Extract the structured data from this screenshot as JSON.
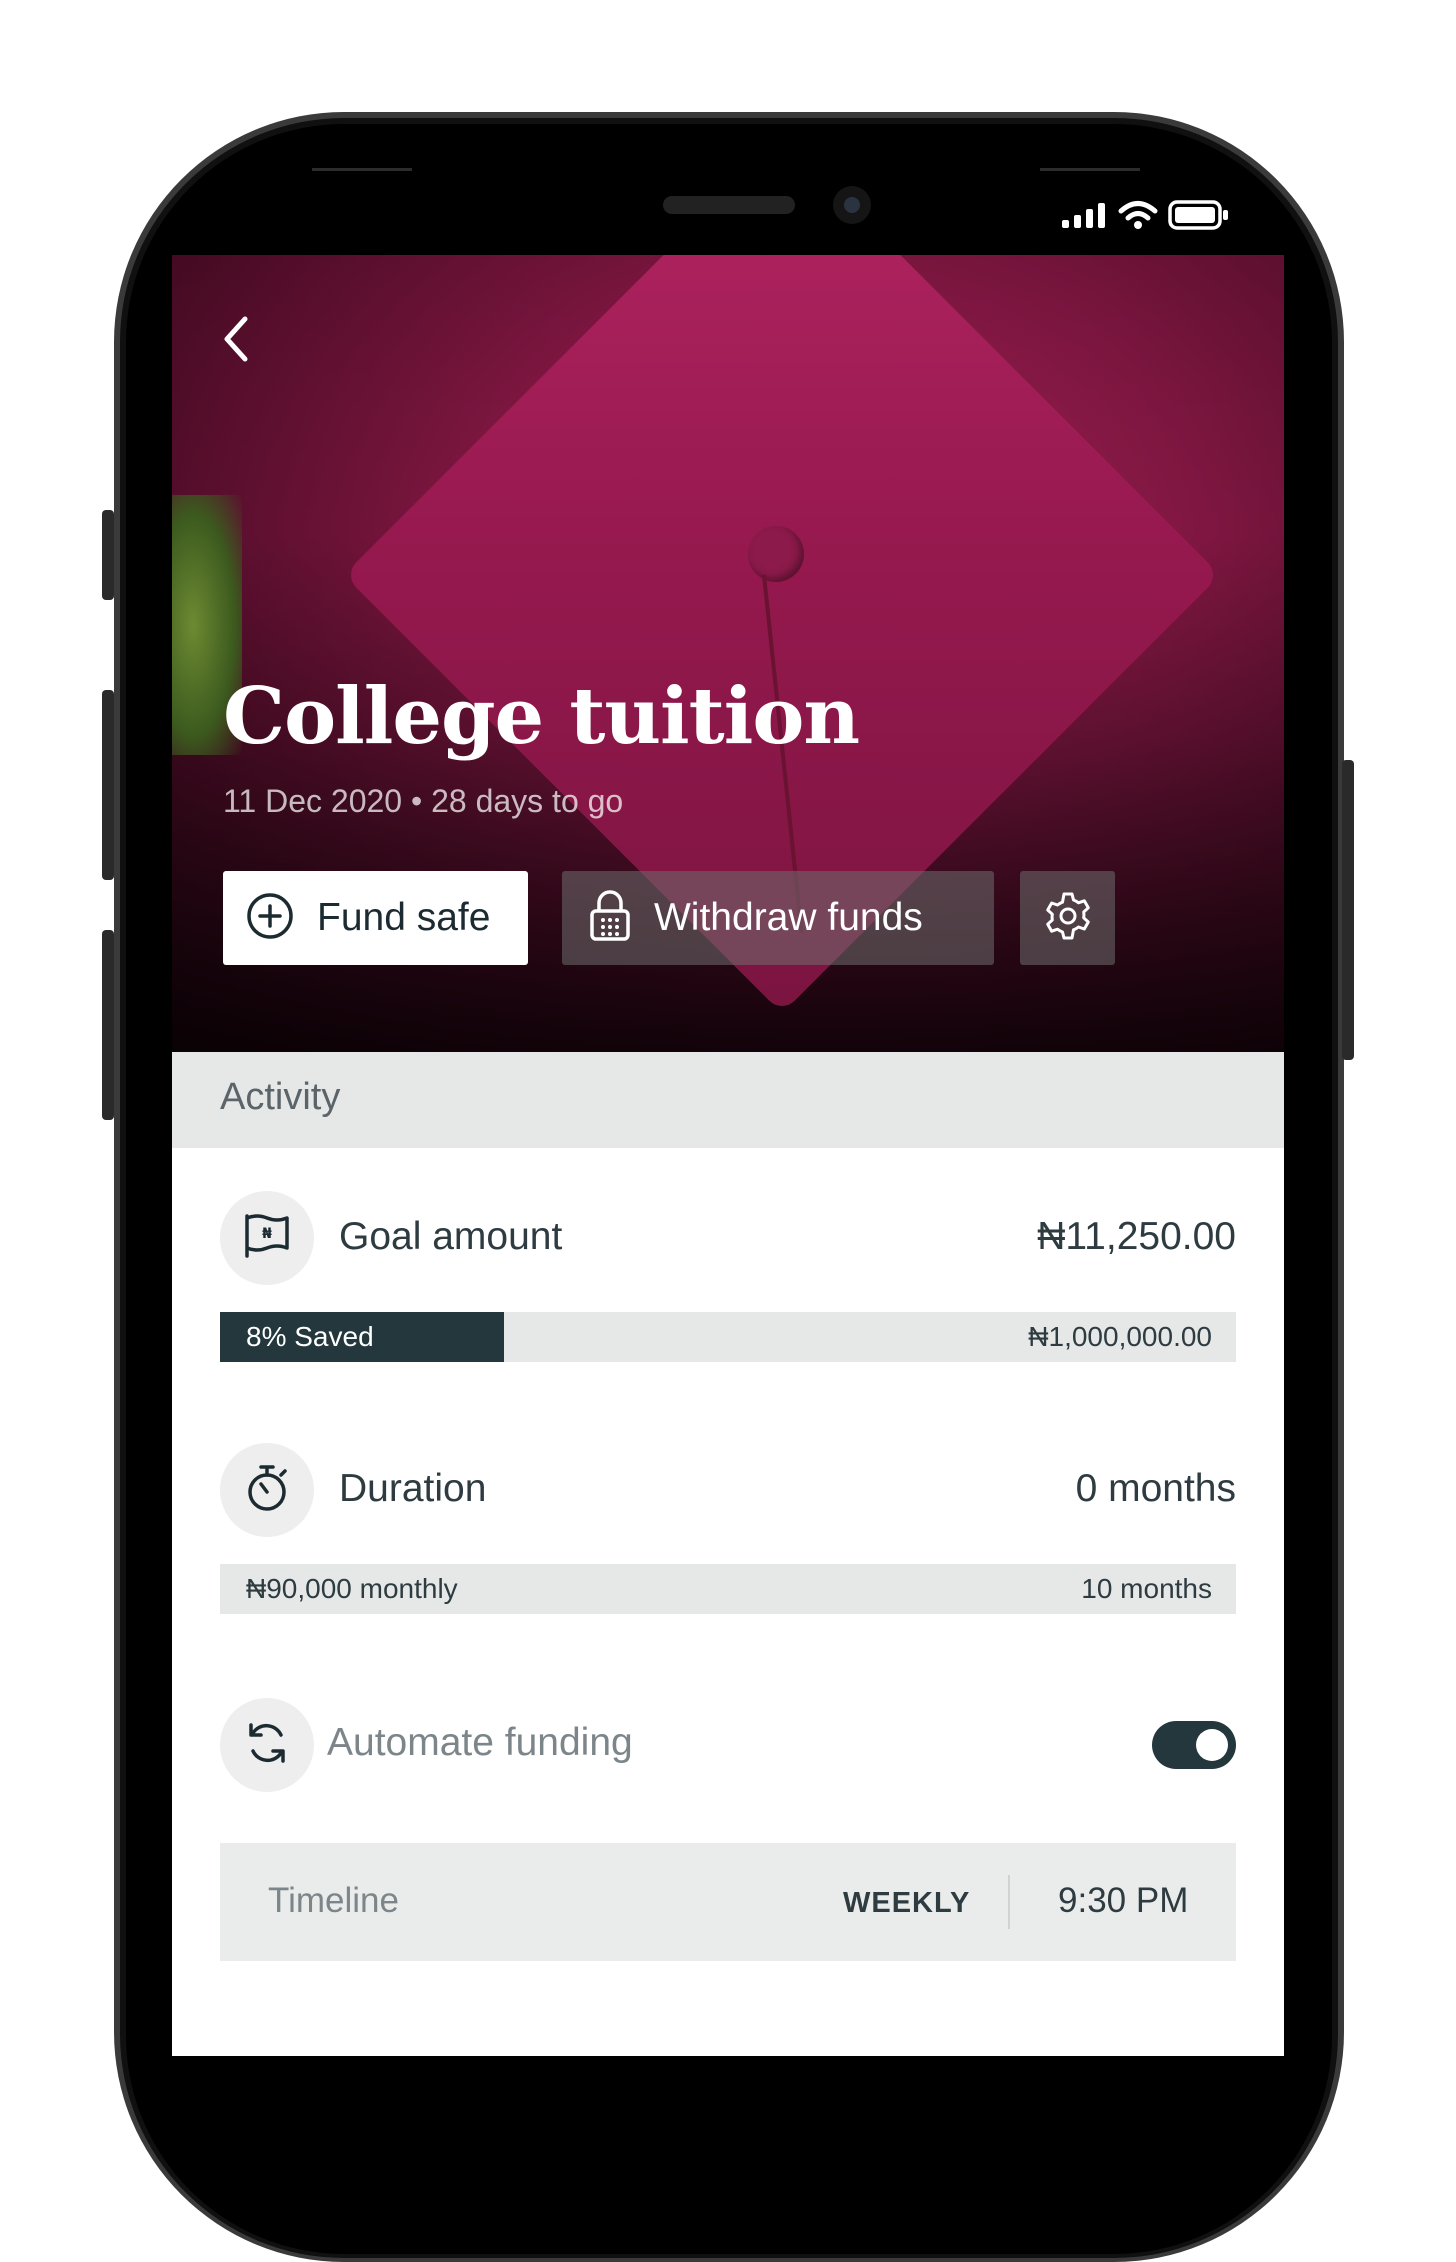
{
  "status_bar": {
    "signal_icon": "cellular-signal-icon",
    "wifi_icon": "wifi-icon",
    "battery_icon": "battery-icon"
  },
  "hero": {
    "back_icon": "chevron-left-icon",
    "title": "College tuition",
    "subtitle": "11 Dec 2020 • 28 days to go",
    "actions": {
      "fund_label": "Fund safe",
      "fund_icon": "plus-circle-icon",
      "withdraw_label": "Withdraw funds",
      "withdraw_icon": "lock-icon",
      "settings_icon": "gear-icon"
    }
  },
  "activity": {
    "header": "Activity",
    "goal": {
      "icon": "naira-flag-icon",
      "label": "Goal amount",
      "value": "₦11,250.00",
      "progress_label": "8% Saved",
      "progress_fraction": 0.28,
      "target": "₦1,000,000.00"
    },
    "duration": {
      "icon": "stopwatch-icon",
      "label": "Duration",
      "value": "0 months",
      "monthly": "₦90,000 monthly",
      "total": "10 months"
    },
    "automate": {
      "icon": "refresh-icon",
      "label": "Automate funding",
      "enabled": true
    },
    "timeline": {
      "label": "Timeline",
      "frequency": "WEEKLY",
      "time": "9:30 PM"
    }
  },
  "colors": {
    "accent_dark": "#24373d",
    "hero_maroon": "#97194f",
    "panel_gray": "#e6e8e7"
  }
}
